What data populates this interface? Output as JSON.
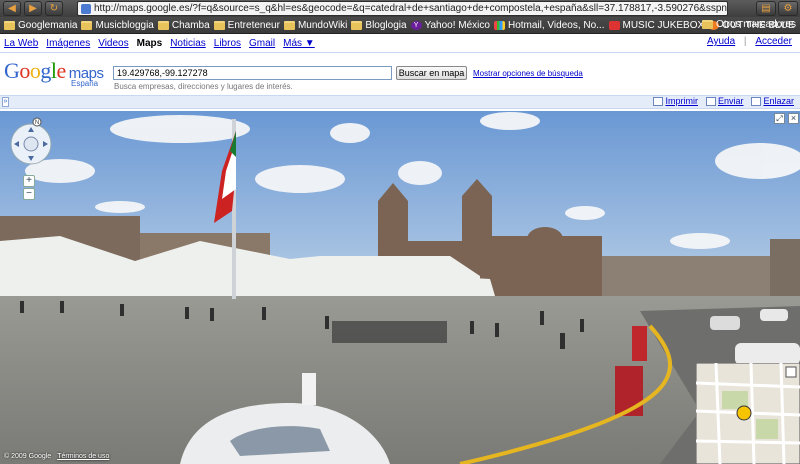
{
  "browser": {
    "url": "http://maps.google.es/?f=q&source=s_q&hl=es&geocode=&q=catedral+de+santiago+de+compostela,+españa&sll=37.178817,-3.590276&sspn=0.01272,0",
    "bookmarks": [
      {
        "label": "Googlemania",
        "icon": "folder-icon"
      },
      {
        "label": "Musicbloggia",
        "icon": "folder-icon"
      },
      {
        "label": "Chamba",
        "icon": "folder-icon"
      },
      {
        "label": "Entreteneur",
        "icon": "folder-icon"
      },
      {
        "label": "MundoWiki",
        "icon": "folder-icon"
      },
      {
        "label": "Bloglogia",
        "icon": "folder-icon"
      },
      {
        "label": "Yahoo! México",
        "icon": "yahoo-icon"
      },
      {
        "label": "Hotmail, Videos, No...",
        "icon": "msn-icon"
      },
      {
        "label": "MUSIC JUKEBOX",
        "icon": "music-icon"
      },
      {
        "label": "OUT THE BLUE",
        "icon": "blogger-icon"
      }
    ],
    "other_bookmarks": "Otros marcadores"
  },
  "google_nav": {
    "items": [
      "La Web",
      "Imágenes",
      "Videos",
      "Maps",
      "Noticias",
      "Libros",
      "Gmail",
      "Más ▼"
    ],
    "current": "Maps",
    "help": "Ayuda",
    "separator": "|",
    "signin": "Acceder"
  },
  "header": {
    "logo_letters": [
      "G",
      "o",
      "o",
      "g",
      "l",
      "e"
    ],
    "product": "maps",
    "country": "España",
    "search_value": "19.429768,-99.127278",
    "search_button": "Buscar en mapa",
    "advanced_link": "Mostrar opciones de búsqueda",
    "hint": "Busca empresas, direcciones y lugares de interés."
  },
  "toolbar_strip": {
    "collapse_glyph": "»",
    "actions": [
      {
        "label": "Imprimir",
        "icon": "print-icon"
      },
      {
        "label": "Enviar",
        "icon": "email-icon"
      },
      {
        "label": "Enlazar",
        "icon": "link-icon"
      }
    ]
  },
  "street_view": {
    "copyright": "© 2009 Google",
    "terms": "Términos de uso",
    "sky_color": "#7ea7d8",
    "ground_color": "#8a8a86"
  }
}
